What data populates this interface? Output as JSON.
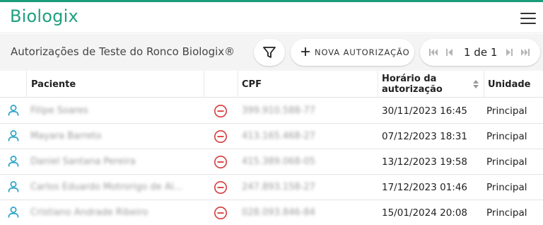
{
  "brand": {
    "logo_text": "Biologix",
    "accent_color": "#1a9b7a"
  },
  "header": {
    "menu_icon": "hamburger-menu-icon"
  },
  "toolbar": {
    "title": "Autorizações de Teste do Ronco Biologix®",
    "filter_icon": "filter-icon",
    "new_button_label": "NOVA AUTORIZAÇÃO",
    "pagination": {
      "label": "1 de 1",
      "current_page": 1,
      "total_pages": 1
    }
  },
  "table": {
    "columns": [
      "Paciente",
      "CPF",
      "Horário da autorização",
      "Unidade"
    ],
    "sorted_column": "Horário da autorização",
    "rows": [
      {
        "patient": "Filipe Soares",
        "cpf": "399.910.588-77",
        "datetime": "30/11/2023 16:45",
        "unit": "Principal"
      },
      {
        "patient": "Mayara Barreto",
        "cpf": "413.165.468-27",
        "datetime": "07/12/2023 18:31",
        "unit": "Principal"
      },
      {
        "patient": "Daniel Santana Pereira",
        "cpf": "415.389.068-05",
        "datetime": "13/12/2023 19:58",
        "unit": "Principal"
      },
      {
        "patient": "Carlos Eduardo Motrorigo de Al...",
        "cpf": "247.893.158-27",
        "datetime": "17/12/2023 01:46",
        "unit": "Principal"
      },
      {
        "patient": "Cristiano Andrade Ribeiro",
        "cpf": "028.093.846-84",
        "datetime": "15/01/2024 20:08",
        "unit": "Principal"
      }
    ]
  }
}
